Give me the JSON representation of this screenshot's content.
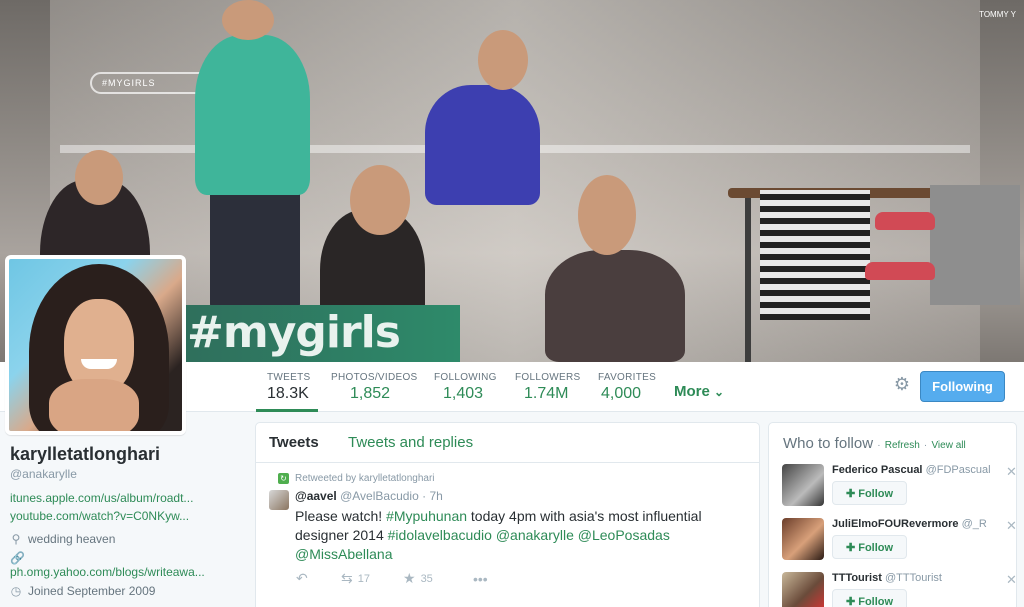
{
  "header": {
    "banner_text": "#mygirls",
    "store_pill_text": "#MYGIRLS",
    "store_sign": "TOMMY Y"
  },
  "nav": {
    "stats": [
      {
        "label": "TWEETS",
        "value": "18.3K"
      },
      {
        "label": "PHOTOS/VIDEOS",
        "value": "1,852"
      },
      {
        "label": "FOLLOWING",
        "value": "1,403"
      },
      {
        "label": "FOLLOWERS",
        "value": "1.74M"
      },
      {
        "label": "FAVORITES",
        "value": "4,000"
      }
    ],
    "more_label": "More",
    "following_button": "Following"
  },
  "profile": {
    "name": "karylletatlonghari",
    "handle": "@anakarylle",
    "links": [
      "itunes.apple.com/us/album/roadt...",
      "youtube.com/watch?v=C0NKyw..."
    ],
    "location": "wedding heaven",
    "website": "ph.omg.yahoo.com/blogs/writeawa...",
    "joined": "Joined September 2009"
  },
  "timeline": {
    "tabs": [
      "Tweets",
      "Tweets and replies"
    ],
    "tweet": {
      "retweeted_by": "Retweeted by karylletatlonghari",
      "author_name": "@aavel",
      "author_handle": "@AvelBacudio",
      "time": "· 7h",
      "text_parts": [
        {
          "t": "Please watch! ",
          "tag": false
        },
        {
          "t": "#Mypuhunan",
          "tag": true
        },
        {
          "t": " today 4pm with asia's most influential designer 2014 ",
          "tag": false
        },
        {
          "t": "#idolavelbacudio",
          "tag": true
        },
        {
          "t": " ",
          "tag": false
        },
        {
          "t": "@anakarylle",
          "tag": true
        },
        {
          "t": " ",
          "tag": false
        },
        {
          "t": "@LeoPosadas",
          "tag": true
        },
        {
          "t": " ",
          "tag": false
        },
        {
          "t": "@MissAbellana",
          "tag": true
        }
      ],
      "retweets": "17",
      "favorites": "35"
    }
  },
  "who_to_follow": {
    "title": "Who to follow",
    "refresh": "Refresh",
    "view_all": "View all",
    "follow_label": "Follow",
    "suggestions": [
      {
        "name": "Federico Pascual",
        "handle": "@FDPascual"
      },
      {
        "name": "JuliElmoFOURevermore",
        "handle": "@_R"
      },
      {
        "name": "TTTourist",
        "handle": "@TTTourist"
      }
    ]
  },
  "colors": {
    "accent": "#2e8b57",
    "follow_button": "#55acee"
  }
}
